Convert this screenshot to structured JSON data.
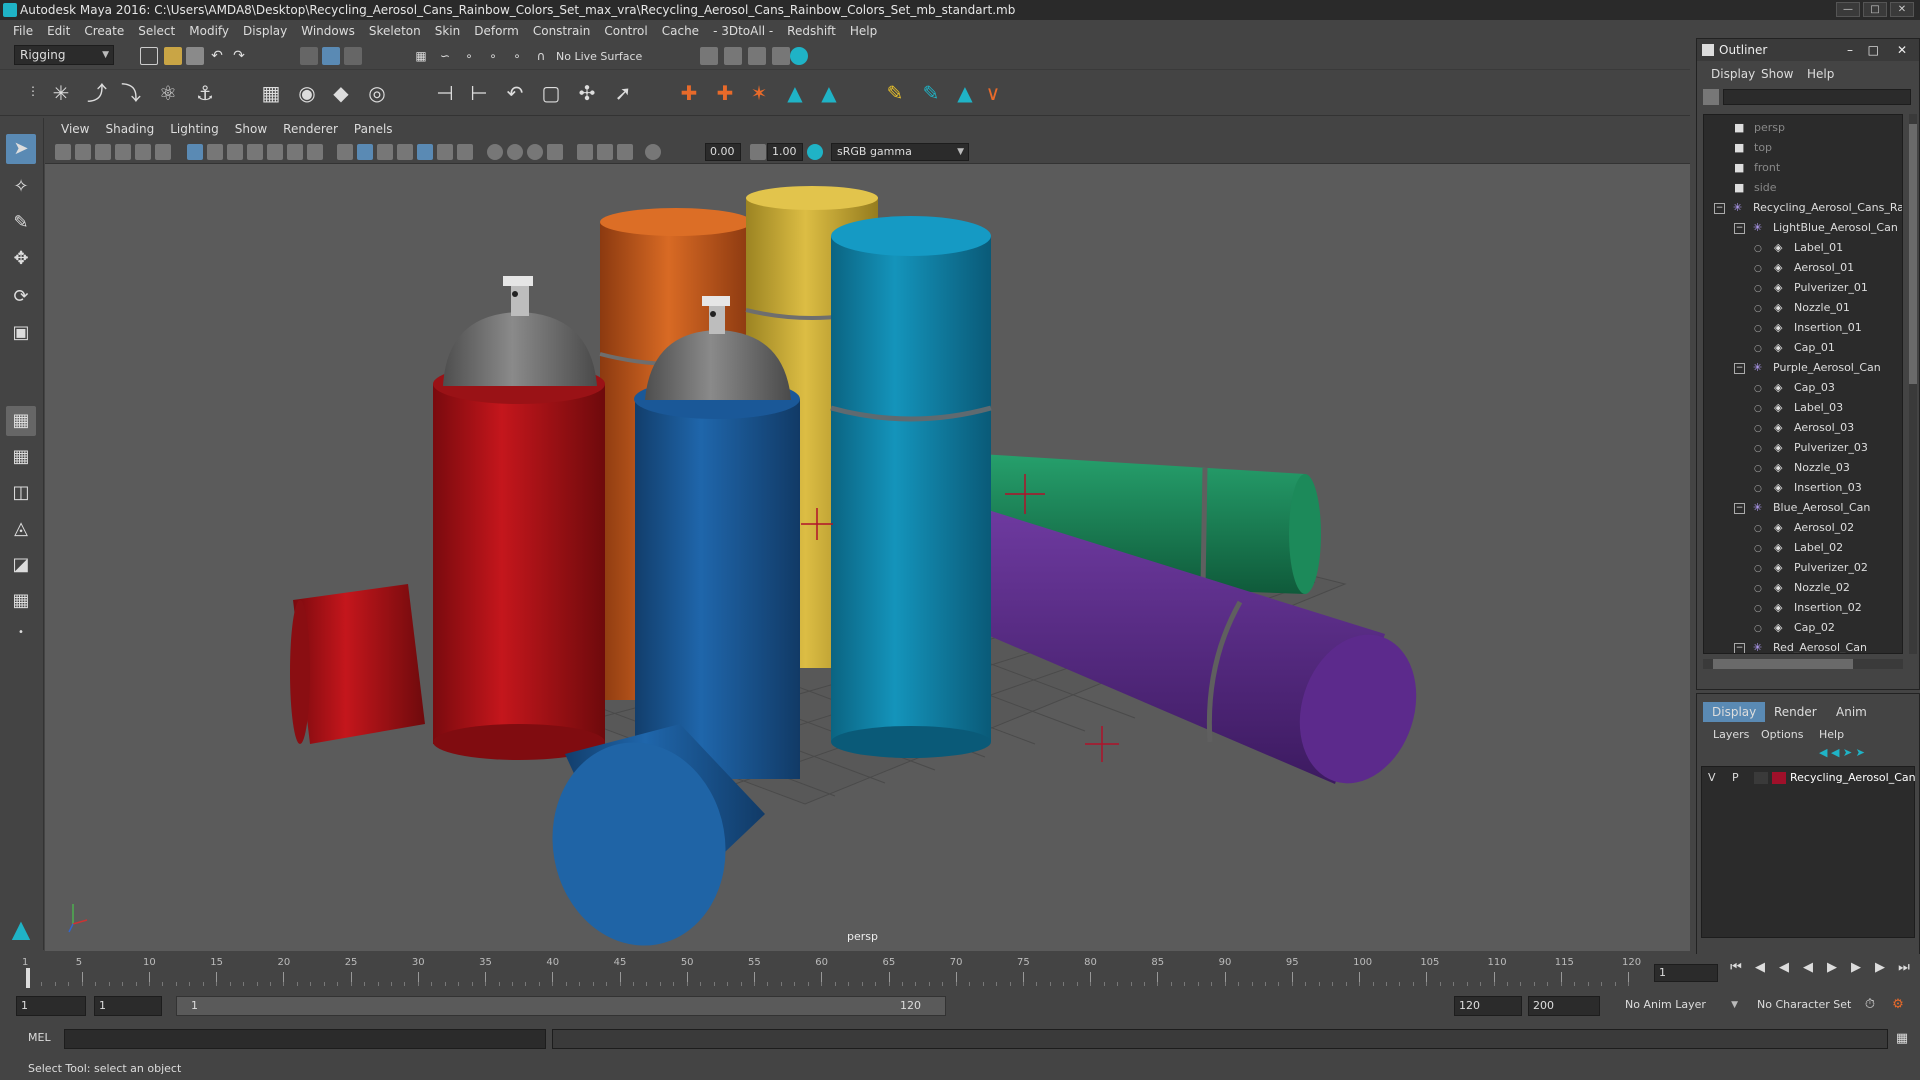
{
  "title": "Autodesk Maya 2016: C:\\Users\\AMDA8\\Desktop\\Recycling_Aerosol_Cans_Rainbow_Colors_Set_max_vra\\Recycling_Aerosol_Cans_Rainbow_Colors_Set_mb_standart.mb",
  "menus": [
    "File",
    "Edit",
    "Create",
    "Select",
    "Modify",
    "Display",
    "Windows",
    "Skeleton",
    "Skin",
    "Deform",
    "Constrain",
    "Control",
    "Cache",
    "- 3DtoAll -",
    "Redshift",
    "Help"
  ],
  "shelf": {
    "mode": "Rigging",
    "live_surface": "No Live Surface"
  },
  "viewport": {
    "menus": [
      "View",
      "Shading",
      "Lighting",
      "Show",
      "Renderer",
      "Panels"
    ],
    "exposure": "0.00",
    "gamma": "1.00",
    "color_space": "sRGB gamma",
    "camera_label": "persp"
  },
  "outliner": {
    "title": "Outliner",
    "menus": [
      "Display",
      "Show",
      "Help"
    ],
    "items": [
      {
        "label": "persp",
        "level": 0,
        "type": "camera",
        "dim": true
      },
      {
        "label": "top",
        "level": 0,
        "type": "camera",
        "dim": true
      },
      {
        "label": "front",
        "level": 0,
        "type": "camera",
        "dim": true
      },
      {
        "label": "side",
        "level": 0,
        "type": "camera",
        "dim": true
      },
      {
        "label": "Recycling_Aerosol_Cans_Ra",
        "level": 0,
        "type": "group"
      },
      {
        "label": "LightBlue_Aerosol_Can",
        "level": 1,
        "type": "group"
      },
      {
        "label": "Label_01",
        "level": 2,
        "type": "mesh"
      },
      {
        "label": "Aerosol_01",
        "level": 2,
        "type": "mesh"
      },
      {
        "label": "Pulverizer_01",
        "level": 2,
        "type": "mesh"
      },
      {
        "label": "Nozzle_01",
        "level": 2,
        "type": "mesh"
      },
      {
        "label": "Insertion_01",
        "level": 2,
        "type": "mesh"
      },
      {
        "label": "Cap_01",
        "level": 2,
        "type": "mesh"
      },
      {
        "label": "Purple_Aerosol_Can",
        "level": 1,
        "type": "group"
      },
      {
        "label": "Cap_03",
        "level": 2,
        "type": "mesh"
      },
      {
        "label": "Label_03",
        "level": 2,
        "type": "mesh"
      },
      {
        "label": "Aerosol_03",
        "level": 2,
        "type": "mesh"
      },
      {
        "label": "Pulverizer_03",
        "level": 2,
        "type": "mesh"
      },
      {
        "label": "Nozzle_03",
        "level": 2,
        "type": "mesh"
      },
      {
        "label": "Insertion_03",
        "level": 2,
        "type": "mesh"
      },
      {
        "label": "Blue_Aerosol_Can",
        "level": 1,
        "type": "group"
      },
      {
        "label": "Aerosol_02",
        "level": 2,
        "type": "mesh"
      },
      {
        "label": "Label_02",
        "level": 2,
        "type": "mesh"
      },
      {
        "label": "Pulverizer_02",
        "level": 2,
        "type": "mesh"
      },
      {
        "label": "Nozzle_02",
        "level": 2,
        "type": "mesh"
      },
      {
        "label": "Insertion_02",
        "level": 2,
        "type": "mesh"
      },
      {
        "label": "Cap_02",
        "level": 2,
        "type": "mesh"
      },
      {
        "label": "Red_Aerosol_Can",
        "level": 1,
        "type": "group"
      }
    ]
  },
  "layer_editor": {
    "tabs": [
      "Display",
      "Render",
      "Anim"
    ],
    "menus": [
      "Layers",
      "Options",
      "Help"
    ],
    "layer": {
      "v": "V",
      "p": "P",
      "name": "Recycling_Aerosol_Can",
      "color": "#a0102a"
    }
  },
  "timeline": {
    "ticks": [
      "1",
      "5",
      "10",
      "15",
      "20",
      "25",
      "30",
      "35",
      "40",
      "45",
      "50",
      "55",
      "60",
      "65",
      "70",
      "75",
      "80",
      "85",
      "90",
      "95",
      "100",
      "105",
      "110",
      "115",
      "120"
    ],
    "current_frame": "1"
  },
  "range": {
    "start": "1",
    "playback_start": "1",
    "slider_start": "1",
    "slider_end": "120",
    "playback_end": "120",
    "end": "200",
    "anim_layer": "No Anim Layer",
    "char_set": "No Character Set"
  },
  "command": {
    "label": "MEL"
  },
  "help_text": "Select Tool: select an object",
  "colors": {
    "accent": "#1fb3c6",
    "red": "#b0141a",
    "blue": "#1c5fa0",
    "cyan": "#148fb3",
    "yellow": "#d4b63a",
    "orange": "#d06020",
    "green": "#1c8a5a",
    "purple": "#5a2a8a"
  }
}
